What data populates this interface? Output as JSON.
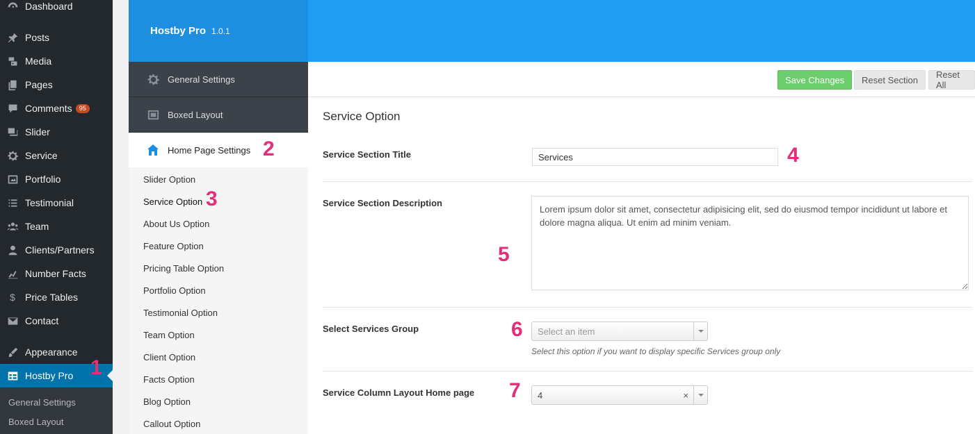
{
  "wp_menu": {
    "items": [
      {
        "label": "Dashboard",
        "icon": "dashboard-icon"
      },
      {
        "label": "Posts",
        "icon": "pin-icon"
      },
      {
        "label": "Media",
        "icon": "media-icon"
      },
      {
        "label": "Pages",
        "icon": "pages-icon"
      },
      {
        "label": "Comments",
        "icon": "comment-icon",
        "badge": "95"
      },
      {
        "label": "Slider",
        "icon": "slider-icon"
      },
      {
        "label": "Service",
        "icon": "gear-icon"
      },
      {
        "label": "Portfolio",
        "icon": "portfolio-icon"
      },
      {
        "label": "Testimonial",
        "icon": "list-icon"
      },
      {
        "label": "Team",
        "icon": "team-icon"
      },
      {
        "label": "Clients/Partners",
        "icon": "user-icon"
      },
      {
        "label": "Number Facts",
        "icon": "chart-icon"
      },
      {
        "label": "Price Tables",
        "icon": "dollar-icon"
      },
      {
        "label": "Contact",
        "icon": "mail-icon"
      },
      {
        "label": "Appearance",
        "icon": "brush-icon"
      },
      {
        "label": "Hostby Pro",
        "icon": "table-icon",
        "active": true
      }
    ],
    "submenu": [
      "General Settings",
      "Boxed Layout"
    ]
  },
  "panel": {
    "title": "Hostby Pro",
    "version": "1.0.1"
  },
  "options_menu": {
    "top": [
      {
        "label": "General Settings",
        "icon": "gear-icon"
      },
      {
        "label": "Boxed Layout",
        "icon": "layout-icon"
      }
    ],
    "active": {
      "label": "Home Page Settings",
      "icon": "home-icon"
    },
    "sub": [
      "Slider Option",
      "Service Option",
      "About Us Option",
      "Feature Option",
      "Pricing Table Option",
      "Portfolio Option",
      "Testimonial Option",
      "Team Option",
      "Client Option",
      "Facts Option",
      "Blog Option",
      "Callout Option"
    ],
    "current": "Service Option"
  },
  "toolbar": {
    "save": "Save Changes",
    "reset_section": "Reset Section",
    "reset_all": "Reset All"
  },
  "section": {
    "title": "Service Option",
    "fields": {
      "title_label": "Service Section Title",
      "title_value": "Services",
      "desc_label": "Service Section Description",
      "desc_value": "Lorem ipsum dolor sit amet, consectetur adipisicing elit, sed do eiusmod tempor incididunt ut labore et dolore magna aliqua. Ut enim ad minim veniam.",
      "group_label": "Select Services Group",
      "group_placeholder": "Select an item",
      "group_help": "Select this option if you want to display specific Services group only",
      "column_label": "Service Column Layout Home page",
      "column_value": "4",
      "column_clear": "×"
    }
  },
  "annotations": [
    "1",
    "2",
    "3",
    "4",
    "5",
    "6",
    "7"
  ],
  "colors": {
    "accent": "#1e9df1",
    "annotation": "#e0307a",
    "save": "#6ccd6c"
  }
}
